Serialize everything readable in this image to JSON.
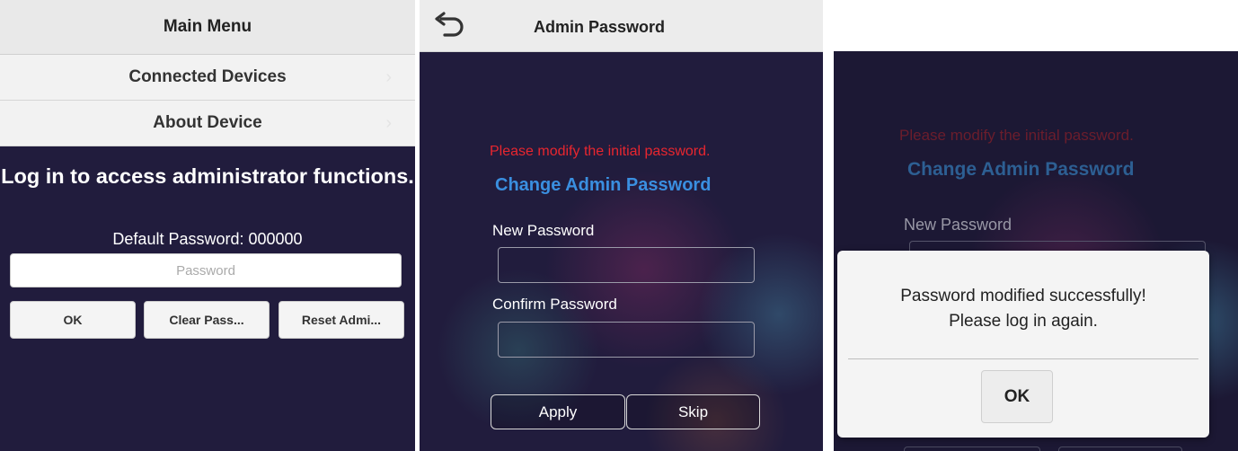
{
  "panel1": {
    "header_title": "Main Menu",
    "menu_items": [
      {
        "label": "Connected Devices",
        "chevron": "›"
      },
      {
        "label": "About Device",
        "chevron": "›"
      }
    ],
    "login_title": "Log in to access administrator functions.",
    "default_password_text": "Default Password: 000000",
    "password_placeholder": "Password",
    "buttons": {
      "ok": "OK",
      "clear": "Clear Pass...",
      "reset": "Reset Admi..."
    }
  },
  "panel2": {
    "back_icon": "back-arrow-icon",
    "title": "Admin Password",
    "warning": "Please modify the initial password.",
    "heading": "Change Admin Password",
    "new_password_label": "New Password",
    "confirm_password_label": "Confirm Password",
    "apply_label": "Apply",
    "skip_label": "Skip"
  },
  "panel3": {
    "warning": "Please modify the initial password.",
    "heading": "Change Admin Password",
    "new_password_label": "New Password",
    "dialog": {
      "line1": "Password modified successfully!",
      "line2": "Please log in again.",
      "ok_label": "OK"
    }
  },
  "colors": {
    "dark_background": "#211c3d",
    "warning_red": "#e8262f",
    "heading_blue": "#3a8fe0",
    "header_gray": "#e9e9e9"
  }
}
